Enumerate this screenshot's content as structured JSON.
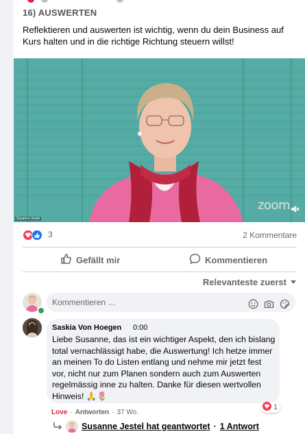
{
  "post": {
    "section_title": "16) AUSWERTEN",
    "text": "Reflektieren und auswerten ist wichtig, wenn du dein Business auf Kurs halten und in die richtige Richtung steuern willst!",
    "video": {
      "participant_name": "Susanne Jestel",
      "app_logo": "zoom",
      "muted_icon": "mic-muted-icon"
    }
  },
  "reactions": {
    "count": "3",
    "comments_label": "2 Kommentare",
    "icons": [
      "love-reaction-icon",
      "like-reaction-icon"
    ]
  },
  "actions": {
    "like_label": "Gefällt mir",
    "comment_label": "Kommentieren"
  },
  "sort": {
    "label": "Relevanteste zuerst"
  },
  "composer": {
    "placeholder": "Kommentieren …"
  },
  "comment": {
    "author": "Saskia Von Hoegen",
    "time": "0:00",
    "text": "Liebe Susanne, das ist ein wichtiger Aspekt, den ich bislang total vernachlässigt habe, die Auswertung! Ich hetze immer an meinen To do Listen entlang und nehme mir jetzt fest vor, nicht nur zum Planen sondern auch zum Auswerten regelmässig inne zu halten. Danke für diesen wertvollen Hinweis! 🙏🌷",
    "love_label": "Love",
    "reply_label": "Antworten",
    "age": "37 Wo.",
    "reaction_count": "1"
  },
  "replies": {
    "text": "Susanne Jestel hat geantwortet",
    "separator": "·",
    "count_label": "1 Antwort"
  },
  "colors": {
    "accent": "#1877f2",
    "love": "#e41e3f",
    "muted_text": "#65676b",
    "bubble": "#f0f2f5"
  }
}
